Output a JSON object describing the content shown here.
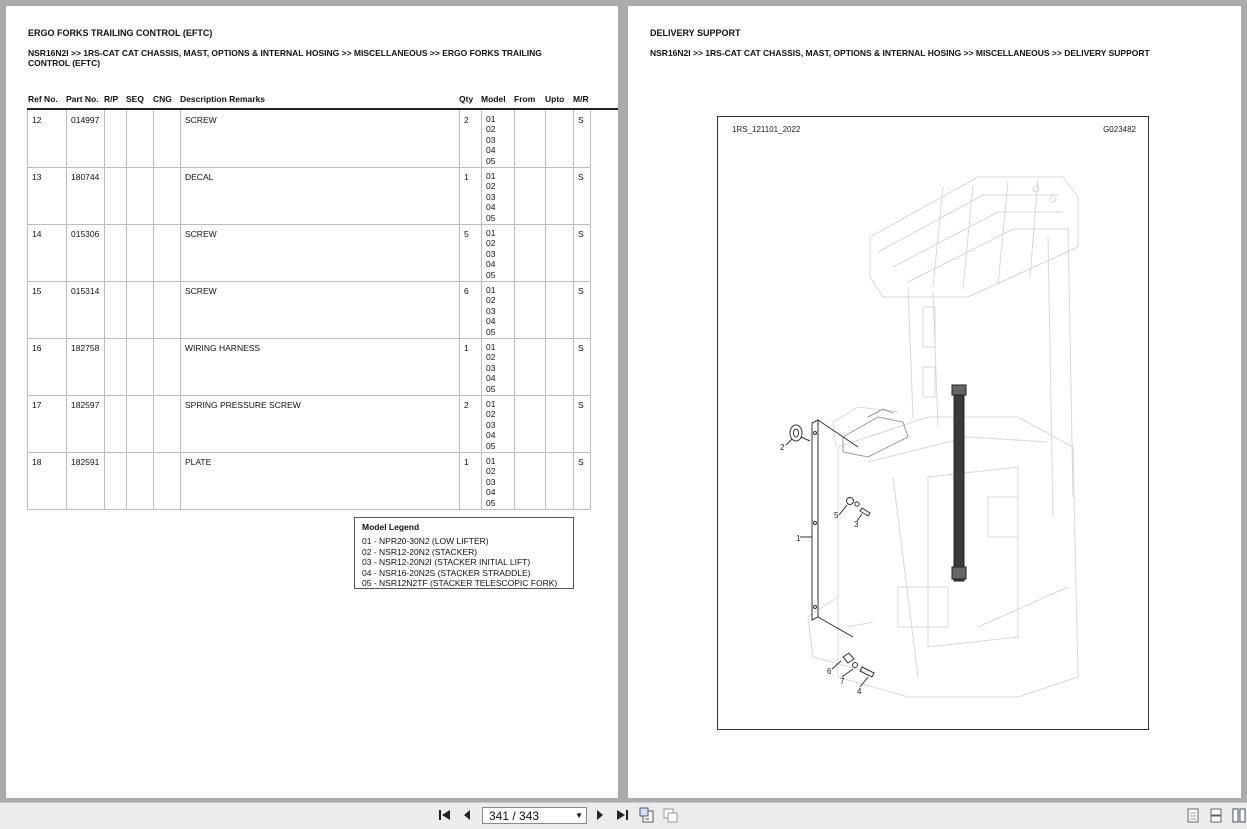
{
  "left_page": {
    "title": "ERGO FORKS TRAILING CONTROL (EFTC)",
    "breadcrumb_line1": "NSR16N2I >> 1RS-CAT CAT CHASSIS, MAST, OPTIONS & INTERNAL HOSING >> MISCELLANEOUS >> ERGO FORKS TRAILING",
    "breadcrumb_line2": "CONTROL (EFTC)",
    "columns": [
      "Ref No.",
      "Part No.",
      "R/P",
      "SEQ",
      "CNG",
      "Description Remarks",
      "Qty",
      "Model",
      "From",
      "Upto",
      "M/R"
    ],
    "rows": [
      {
        "ref": "12",
        "part": "014997",
        "desc": "SCREW",
        "qty": "2",
        "models": [
          "01",
          "02",
          "03",
          "04",
          "05"
        ],
        "mr": "S"
      },
      {
        "ref": "13",
        "part": "180744",
        "desc": "DECAL",
        "qty": "1",
        "models": [
          "01",
          "02",
          "03",
          "04",
          "05"
        ],
        "mr": "S"
      },
      {
        "ref": "14",
        "part": "015306",
        "desc": "SCREW",
        "qty": "5",
        "models": [
          "01",
          "02",
          "03",
          "04",
          "05"
        ],
        "mr": "S"
      },
      {
        "ref": "15",
        "part": "015314",
        "desc": "SCREW",
        "qty": "6",
        "models": [
          "01",
          "02",
          "03",
          "04",
          "05"
        ],
        "mr": "S"
      },
      {
        "ref": "16",
        "part": "182758",
        "desc": "WIRING HARNESS",
        "qty": "1",
        "models": [
          "01",
          "02",
          "03",
          "04",
          "05"
        ],
        "mr": "S"
      },
      {
        "ref": "17",
        "part": "182597",
        "desc": "SPRING PRESSURE SCREW",
        "qty": "2",
        "models": [
          "01",
          "02",
          "03",
          "04",
          "05"
        ],
        "mr": "S"
      },
      {
        "ref": "18",
        "part": "182591",
        "desc": "PLATE",
        "qty": "1",
        "models": [
          "01",
          "02",
          "03",
          "04",
          "05"
        ],
        "mr": "S"
      }
    ],
    "legend": {
      "title": "Model Legend",
      "items": [
        "01 - NPR20-30N2 (LOW LIFTER)",
        "02 - NSR12-20N2 (STACKER)",
        "03 - NSR12-20N2I (STACKER INITIAL LIFT)",
        "04 - NSR16-20N2S (STACKER STRADDLE)",
        "05 - NSR12N2TF (STACKER TELESCOPIC FORK)"
      ]
    }
  },
  "right_page": {
    "title": "DELIVERY SUPPORT",
    "breadcrumb": "NSR16N2I >> 1RS-CAT CAT CHASSIS, MAST, OPTIONS & INTERNAL HOSING >> MISCELLANEOUS >> DELIVERY SUPPORT",
    "figure": {
      "ref_code": "1RS_121101_2022",
      "drawing_id": "G023482",
      "callouts": [
        "1",
        "2",
        "3",
        "4",
        "5",
        "6",
        "7"
      ]
    }
  },
  "toolbar": {
    "page_indicator": "341 / 343",
    "icons": [
      "first-page-icon",
      "previous-page-icon",
      "next-page-icon",
      "last-page-icon",
      "rotate-icon",
      "copy-icon",
      "single-page-view-icon",
      "continuous-view-icon",
      "two-page-view-icon"
    ]
  }
}
